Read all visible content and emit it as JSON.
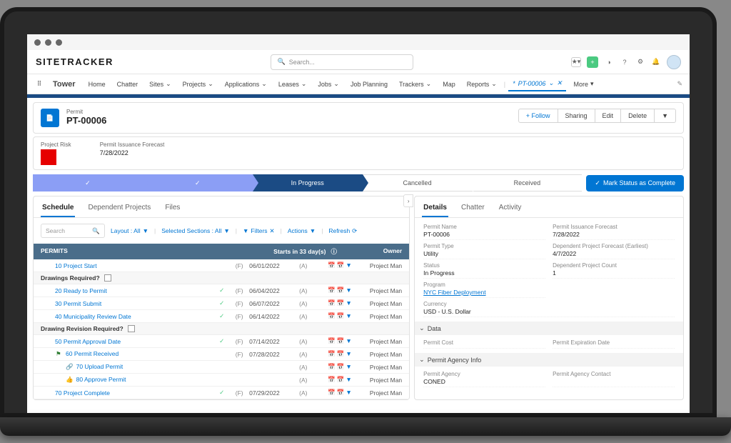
{
  "brand": "SITETRACKER",
  "search_placeholder": "Search...",
  "app_name": "Tower",
  "nav": [
    "Home",
    "Chatter",
    "Sites",
    "Projects",
    "Applications",
    "Leases",
    "Jobs",
    "Job Planning",
    "Trackers",
    "Map",
    "Reports"
  ],
  "open_tab": "PT-00006",
  "more": "More",
  "record": {
    "type": "Permit",
    "name": "PT-00006",
    "actions": {
      "follow": "Follow",
      "sharing": "Sharing",
      "edit": "Edit",
      "delete": "Delete"
    }
  },
  "risk": {
    "label": "Project Risk",
    "forecast_label": "Permit Issuance Forecast",
    "forecast_date": "7/28/2022"
  },
  "path": {
    "stages": [
      "",
      "",
      "In Progress",
      "Cancelled",
      "Received"
    ],
    "button": "Mark Status as Complete"
  },
  "left_tabs": [
    "Schedule",
    "Dependent Projects",
    "Files"
  ],
  "toolbar": {
    "search": "Search",
    "layout": "Layout : All",
    "sections": "Selected Sections : All",
    "filters": "Filters",
    "actions": "Actions",
    "refresh": "Refresh"
  },
  "grid_header": {
    "title": "PERMITS",
    "starts": "Starts in 33 day(s)",
    "owner": "Owner"
  },
  "sections": [
    {
      "label": "Drawings Required?"
    },
    {
      "label": "Drawing Revision Required?"
    }
  ],
  "rows": [
    {
      "name": "10 Project Start",
      "f": "(F)",
      "date": "06/01/2022",
      "a": "(A)",
      "owner": "Project Man"
    },
    {
      "name": "20 Ready to Permit",
      "f": "(F)",
      "date": "06/04/2022",
      "a": "(A)",
      "owner": "Project Man",
      "check": true
    },
    {
      "name": "30 Permit Submit",
      "f": "(F)",
      "date": "06/07/2022",
      "a": "(A)",
      "owner": "Project Man",
      "check": true
    },
    {
      "name": "40 Municipality Review Date",
      "f": "(F)",
      "date": "06/14/2022",
      "a": "(A)",
      "owner": "Project Man",
      "check": true
    },
    {
      "name": "50 Permit Approval Date",
      "f": "(F)",
      "date": "07/14/2022",
      "a": "(A)",
      "owner": "Project Man",
      "check": true
    },
    {
      "name": "60 Permit Received",
      "f": "(F)",
      "date": "07/28/2022",
      "a": "(A)",
      "owner": "Project Man",
      "flag": true
    },
    {
      "name": "70 Upload Permit",
      "f": "",
      "date": "",
      "a": "(A)",
      "owner": "Project Man",
      "sub": true,
      "icon": "link"
    },
    {
      "name": "80 Approve Permit",
      "f": "",
      "date": "",
      "a": "(A)",
      "owner": "Project Man",
      "sub": true,
      "icon": "approve"
    },
    {
      "name": "70 Project Complete",
      "f": "(F)",
      "date": "07/29/2022",
      "a": "(A)",
      "owner": "Project Man",
      "check": true
    }
  ],
  "right_tabs": [
    "Details",
    "Chatter",
    "Activity"
  ],
  "details": {
    "permit_name": {
      "l": "Permit Name",
      "v": "PT-00006"
    },
    "issuance": {
      "l": "Permit Issuance Forecast",
      "v": "7/28/2022"
    },
    "permit_type": {
      "l": "Permit Type",
      "v": "Utility"
    },
    "dep_forecast": {
      "l": "Dependent Project Forecast (Earliest)",
      "v": "4/7/2022"
    },
    "status": {
      "l": "Status",
      "v": "In Progress"
    },
    "dep_count": {
      "l": "Dependent Project Count",
      "v": "1"
    },
    "program": {
      "l": "Program",
      "v": "NYC Fiber Deployment"
    },
    "currency": {
      "l": "Currency",
      "v": "USD - U.S. Dollar"
    },
    "section_data": "Data",
    "permit_cost": {
      "l": "Permit Cost",
      "v": ""
    },
    "permit_exp": {
      "l": "Permit Expiration Date",
      "v": ""
    },
    "section_agency": "Permit Agency Info",
    "permit_agency": {
      "l": "Permit Agency",
      "v": "CONED"
    },
    "agency_contact": {
      "l": "Permit Agency Contact",
      "v": ""
    }
  }
}
